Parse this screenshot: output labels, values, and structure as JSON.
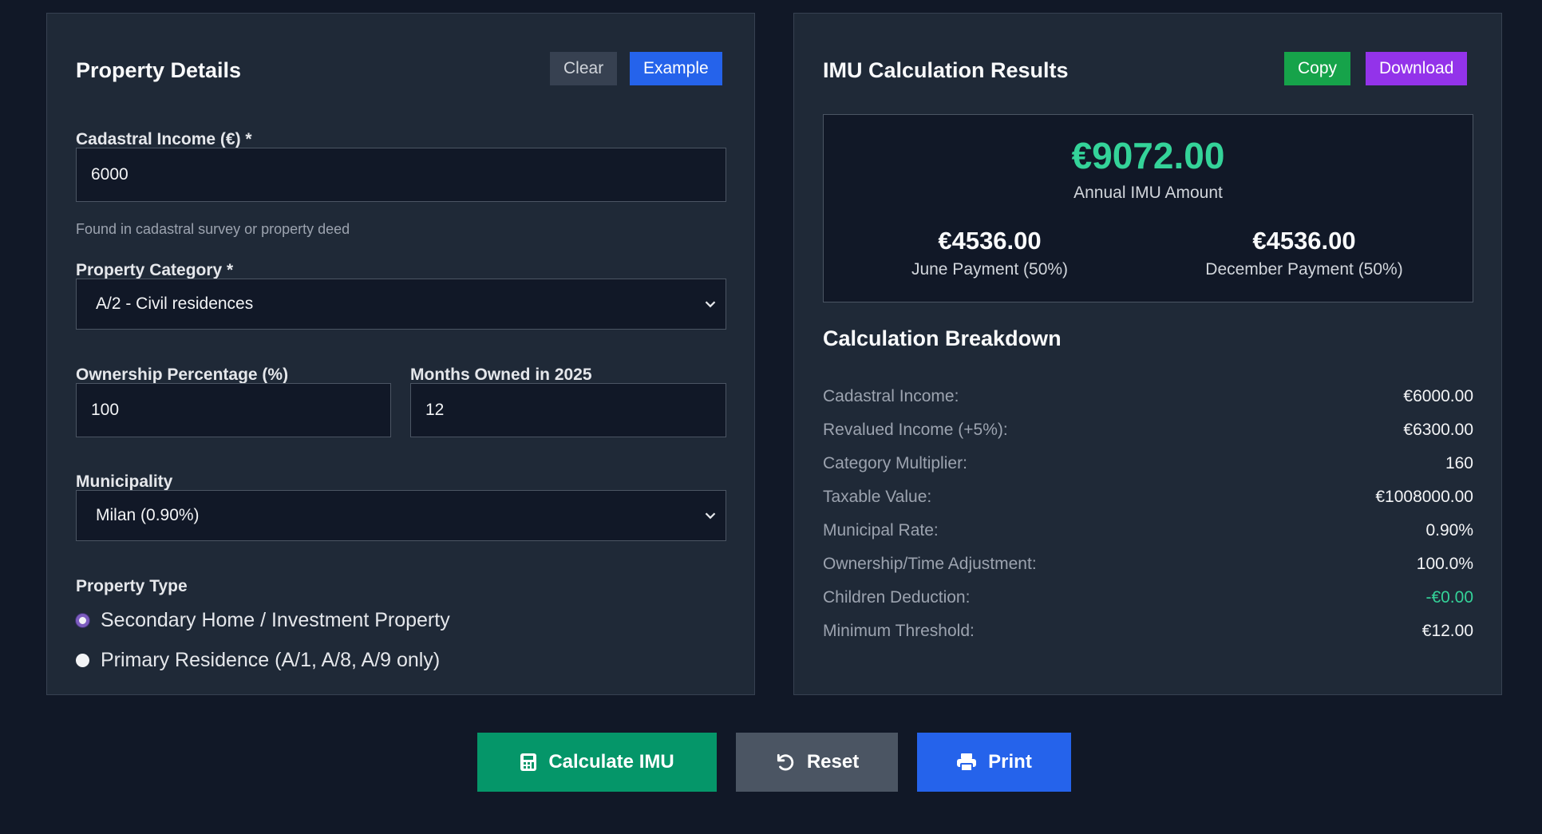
{
  "property_panel": {
    "title": "Property Details",
    "clear_label": "Clear",
    "example_label": "Example",
    "cadastral_label": "Cadastral Income (€) *",
    "cadastral_value": "6000",
    "cadastral_hint": "Found in cadastral survey or property deed",
    "category_label": "Property Category *",
    "category_value": "A/2 - Civil residences",
    "ownership_label": "Ownership Percentage (%)",
    "ownership_value": "100",
    "months_label": "Months Owned in 2025",
    "months_value": "12",
    "municipality_label": "Municipality",
    "municipality_value": "Milan (0.90%)",
    "property_type_label": "Property Type",
    "property_type_options": [
      {
        "label": "Secondary Home / Investment Property",
        "selected": true
      },
      {
        "label": "Primary Residence (A/1, A/8, A/9 only)",
        "selected": false
      }
    ]
  },
  "results_panel": {
    "title": "IMU Calculation Results",
    "copy_label": "Copy",
    "download_label": "Download",
    "annual_amount": "€9072.00",
    "annual_label": "Annual IMU Amount",
    "june_amount": "€4536.00",
    "june_label": "June Payment (50%)",
    "december_amount": "€4536.00",
    "december_label": "December Payment (50%)",
    "breakdown_title": "Calculation Breakdown",
    "breakdown": [
      {
        "label": "Cadastral Income:",
        "value": "€6000.00"
      },
      {
        "label": "Revalued Income (+5%):",
        "value": "€6300.00"
      },
      {
        "label": "Category Multiplier:",
        "value": "160"
      },
      {
        "label": "Taxable Value:",
        "value": "€1008000.00"
      },
      {
        "label": "Municipal Rate:",
        "value": "0.90%"
      },
      {
        "label": "Ownership/Time Adjustment:",
        "value": "100.0%"
      },
      {
        "label": "Children Deduction:",
        "value": "-€0.00"
      },
      {
        "label": "Minimum Threshold:",
        "value": "€12.00"
      }
    ]
  },
  "actions": {
    "calculate_label": "Calculate IMU",
    "reset_label": "Reset",
    "print_label": "Print"
  },
  "colors": {
    "background": "#111827",
    "panel": "#1f2937",
    "accent_green": "#34d399",
    "calculate_green": "#059669",
    "blue": "#2563eb",
    "purple": "#9333ea",
    "copy_green": "#16a34a",
    "reset_gray": "#4b5563"
  },
  "icons": {
    "calculate": "calculator-icon",
    "reset": "undo-icon",
    "print": "printer-icon",
    "select": "chevron-down-icon"
  }
}
